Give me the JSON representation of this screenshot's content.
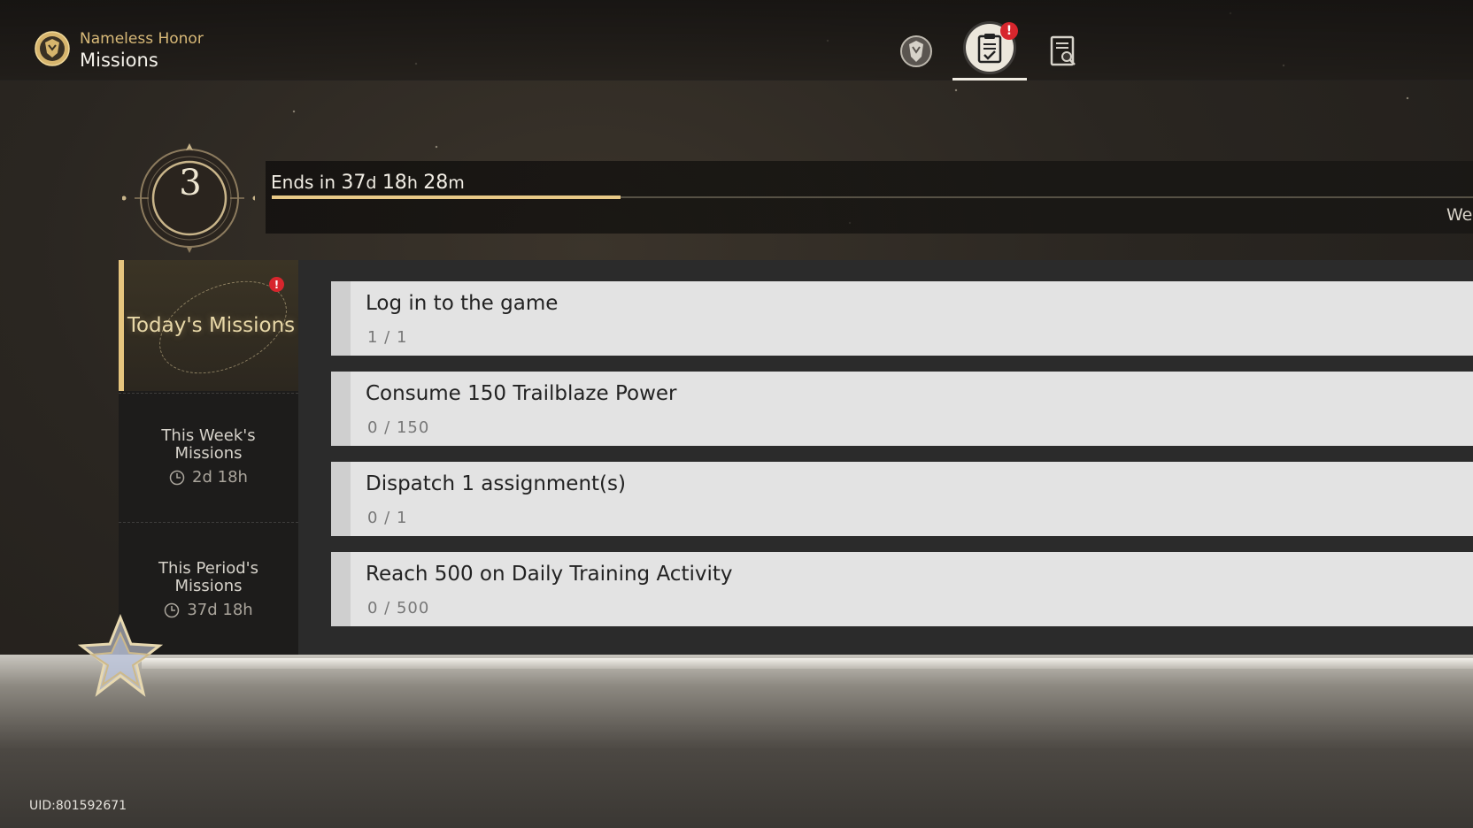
{
  "header": {
    "subtitle": "Nameless Honor",
    "title": "Missions",
    "tabs": [
      {
        "icon": "honor-emblem-icon",
        "active": false
      },
      {
        "icon": "mission-clipboard-icon",
        "active": true,
        "badge": "!"
      },
      {
        "icon": "records-search-icon",
        "active": false
      }
    ]
  },
  "level": {
    "value": "3"
  },
  "period": {
    "prefix": "Ends in",
    "days": "37",
    "days_unit": "d",
    "hours": "18",
    "hours_unit": "h",
    "minutes": "28",
    "minutes_unit": "m",
    "progress_fraction": 0.29,
    "right_text": "We"
  },
  "sidebar": {
    "today": {
      "label": "Today's Missions",
      "badge": "!"
    },
    "week": {
      "label_line1": "This Week's",
      "label_line2": "Missions",
      "timer": "2d 18h"
    },
    "period": {
      "label_line1": "This Period's",
      "label_line2": "Missions",
      "timer": "37d 18h"
    }
  },
  "missions": [
    {
      "title": "Log in to the game",
      "progress": "1 / 1"
    },
    {
      "title": "Consume 150 Trailblaze Power",
      "progress": "0 / 150"
    },
    {
      "title": "Dispatch 1 assignment(s)",
      "progress": "0 / 1"
    },
    {
      "title": "Reach 500 on Daily Training Activity",
      "progress": "0 / 500"
    }
  ],
  "footer": {
    "uid": "UID:801592671"
  },
  "colors": {
    "accent_gold": "#e6c57e",
    "badge_red": "#d7262d",
    "card_bg": "#e3e3e3"
  }
}
